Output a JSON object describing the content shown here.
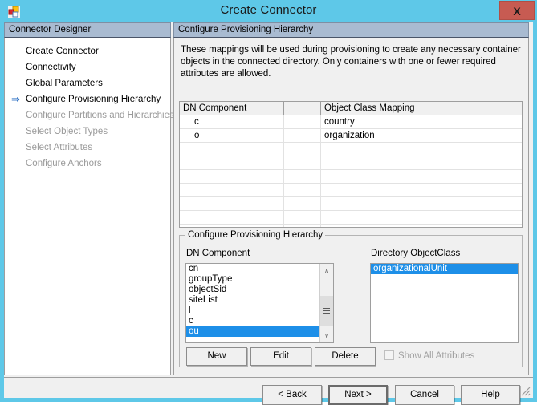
{
  "window": {
    "title": "Create Connector",
    "app_icon": "application-squares-icon",
    "close_label": "X",
    "accent_border_color": "#5ec8e8",
    "titlebar_color": "#5ec8e8",
    "close_button_color": "#c75b52",
    "selection_color": "#1d8fe8",
    "header_band_color": "#a9bbd1"
  },
  "sidebar": {
    "header": "Connector Designer",
    "current_arrow": "⇒",
    "items": [
      {
        "label": "Create Connector",
        "state": "enabled",
        "current": false
      },
      {
        "label": "Connectivity",
        "state": "enabled",
        "current": false
      },
      {
        "label": "Global Parameters",
        "state": "enabled",
        "current": false
      },
      {
        "label": "Configure Provisioning Hierarchy",
        "state": "enabled",
        "current": true
      },
      {
        "label": "Configure Partitions and Hierarchies",
        "state": "disabled",
        "current": false
      },
      {
        "label": "Select Object Types",
        "state": "disabled",
        "current": false
      },
      {
        "label": "Select Attributes",
        "state": "disabled",
        "current": false
      },
      {
        "label": "Configure Anchors",
        "state": "disabled",
        "current": false
      }
    ]
  },
  "main": {
    "header": "Configure Provisioning Hierarchy",
    "description": "These mappings will be used during provisioning to create any necessary container objects in the connected directory.  Only containers with one or fewer required attributes are allowed.",
    "grid": {
      "columns": [
        "DN Component",
        "",
        "Object Class Mapping",
        ""
      ],
      "rows": [
        {
          "dn_component": "c",
          "spacer": "",
          "object_class_mapping": "country",
          "trailing": ""
        },
        {
          "dn_component": "o",
          "spacer": "",
          "object_class_mapping": "organization",
          "trailing": ""
        }
      ],
      "empty_row_count": 7
    },
    "groupbox": {
      "title": "Configure Provisioning Hierarchy",
      "dn_component_label": "DN Component",
      "directory_objectclass_label": "Directory ObjectClass",
      "dn_component_items": [
        {
          "label": "cn",
          "selected": false
        },
        {
          "label": "groupType",
          "selected": false
        },
        {
          "label": "objectSid",
          "selected": false
        },
        {
          "label": "siteList",
          "selected": false
        },
        {
          "label": "l",
          "selected": false
        },
        {
          "label": "c",
          "selected": false
        },
        {
          "label": "ou",
          "selected": true
        }
      ],
      "directory_objectclass_items": [
        {
          "label": "organizationalUnit",
          "selected": true
        }
      ],
      "scrollbar": {
        "up_arrow": "∧",
        "down_arrow": "∨"
      },
      "buttons": {
        "new": "New",
        "edit": "Edit",
        "delete": "Delete"
      },
      "show_all_attributes": {
        "label": "Show All Attributes",
        "checked": false,
        "enabled": false
      }
    }
  },
  "footer": {
    "back": "< Back",
    "next": "Next >",
    "cancel": "Cancel",
    "help": "Help"
  }
}
